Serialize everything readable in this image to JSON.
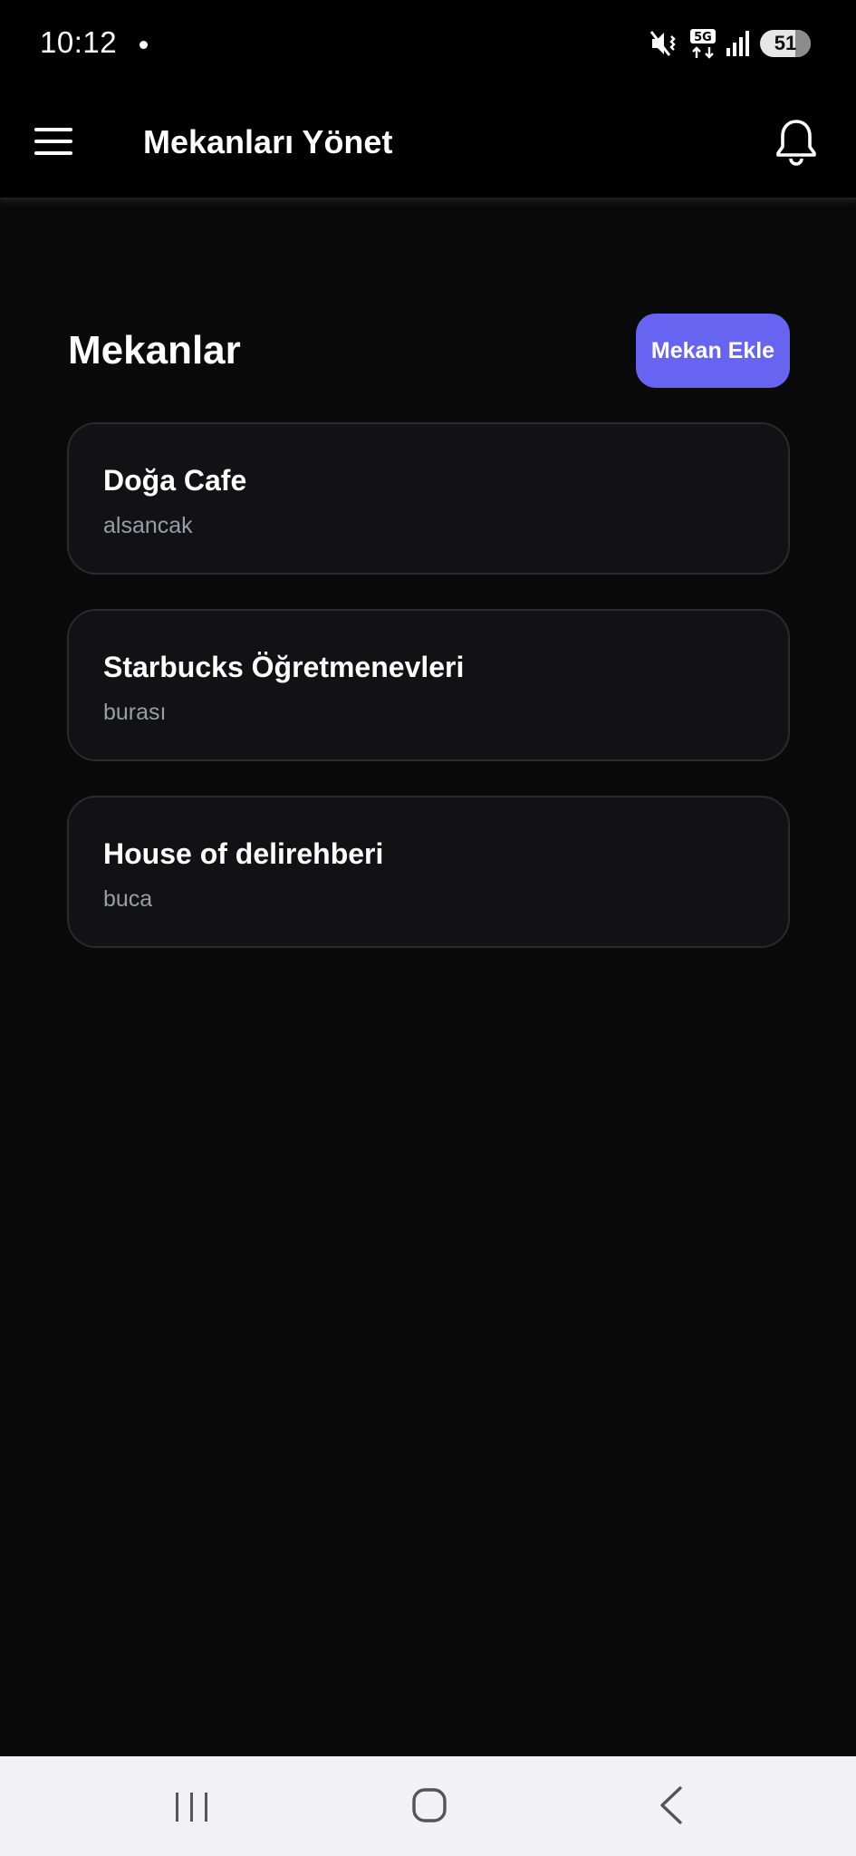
{
  "status_bar": {
    "time": "10:12",
    "network": "5G",
    "battery": "51",
    "icons": [
      "notification-dot-icon",
      "mute-vibrate-icon",
      "5g-data-icon",
      "signal-icon",
      "battery-icon"
    ]
  },
  "app_bar": {
    "title": "Mekanları Yönet",
    "left_icon": "menu-icon",
    "right_icon": "bell-icon"
  },
  "section": {
    "title": "Mekanlar",
    "add_button_label": "Mekan Ekle",
    "accent_color": "#6664f0"
  },
  "venues": [
    {
      "name": "Doğa Cafe",
      "location": "alsancak"
    },
    {
      "name": "Starbucks Öğretmenevleri",
      "location": "burası"
    },
    {
      "name": "House of delirehberi",
      "location": "buca"
    }
  ],
  "nav_bar": {
    "icons": [
      "recent-apps-icon",
      "home-icon",
      "back-icon"
    ]
  },
  "colors": {
    "background": "#0a0a0b",
    "card": "#121215",
    "secondary_text": "#9a9ca8"
  }
}
